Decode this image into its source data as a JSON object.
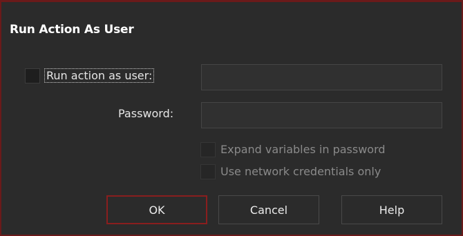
{
  "dialog": {
    "title": "Run Action As User"
  },
  "run_as_user": {
    "label": "Run action as user:",
    "checked": false,
    "value": ""
  },
  "password": {
    "label": "Password:",
    "value": ""
  },
  "expand_variables": {
    "label": "Expand variables in password",
    "checked": false,
    "enabled": false
  },
  "network_credentials": {
    "label": "Use network credentials only",
    "checked": false,
    "enabled": false
  },
  "buttons": {
    "ok": "OK",
    "cancel": "Cancel",
    "help": "Help"
  },
  "colors": {
    "background": "#2b2b2b",
    "frame": "#5a1616",
    "default_button_border": "#8a1e1e",
    "text": "#e6e6e6"
  }
}
